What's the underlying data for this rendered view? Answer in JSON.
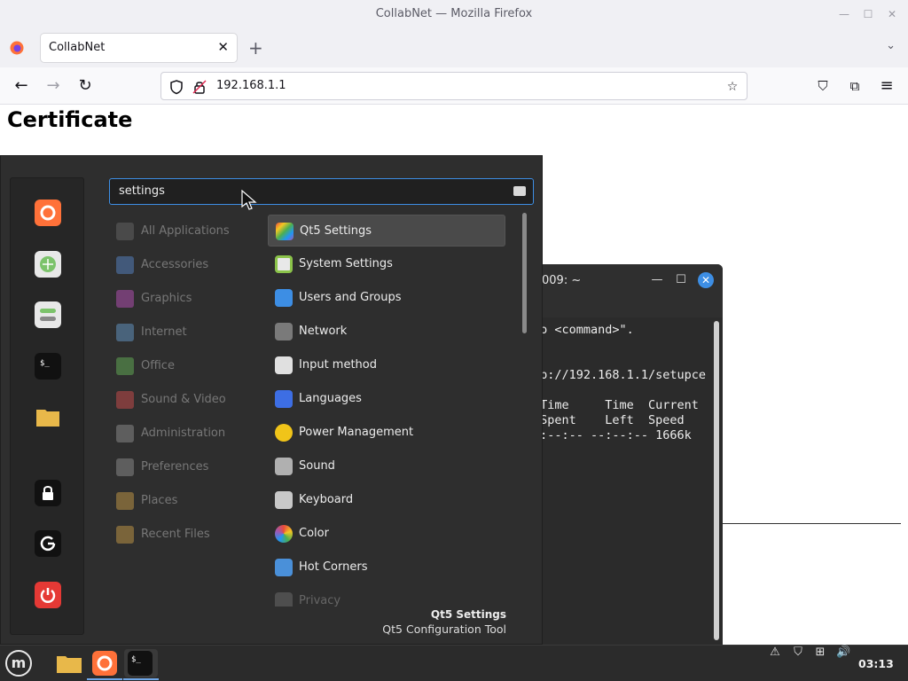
{
  "window": {
    "title": "CollabNet — Mozilla Firefox",
    "minimize_icon": "—",
    "maximize_icon": "☐",
    "close_icon": "✕"
  },
  "browser": {
    "tab_label": "CollabNet",
    "tab_close_icon": "✕",
    "new_tab_icon": "+",
    "tab_list_icon": "⌄",
    "back_icon": "←",
    "forward_icon": "→",
    "reload_icon": "↻",
    "url": "192.168.1.1",
    "bookmark_icon": "☆",
    "pocket_icon": "⛉",
    "extensions_icon": "⧉",
    "menu_icon": "≡"
  },
  "page": {
    "heading": "Certificate"
  },
  "terminal": {
    "title": "009: ~",
    "lines": [
      "do <command>\".",
      "",
      "tp://192.168.1.1/setupce",
      "",
      " Time     Time  Current",
      " Spent    Left  Speed",
      "-:--:-- --:--:-- 1666k"
    ]
  },
  "menu": {
    "search_value": "settings",
    "categories": [
      {
        "label": "All Applications",
        "color": "#6d6d6d"
      },
      {
        "label": "Accessories",
        "color": "#5a8fd6"
      },
      {
        "label": "Graphics",
        "color": "#c855c8"
      },
      {
        "label": "Internet",
        "color": "#6aa3d9"
      },
      {
        "label": "Office",
        "color": "#6bbf5b"
      },
      {
        "label": "Sound & Video",
        "color": "#e05050"
      },
      {
        "label": "Administration",
        "color": "#9a9a9a"
      },
      {
        "label": "Preferences",
        "color": "#9a9a9a"
      },
      {
        "label": "Places",
        "color": "#d8a64a"
      },
      {
        "label": "Recent Files",
        "color": "#d8a64a"
      }
    ],
    "apps": [
      {
        "label": "Qt5 Settings",
        "color": "#9b59b6"
      },
      {
        "label": "System Settings",
        "color": "#8bc34a"
      },
      {
        "label": "Users and Groups",
        "color": "#3d8ee4"
      },
      {
        "label": "Network",
        "color": "#7a7a7a"
      },
      {
        "label": "Input method",
        "color": "#e0e0e0"
      },
      {
        "label": "Languages",
        "color": "#3d6ee4"
      },
      {
        "label": "Power Management",
        "color": "#f0c419"
      },
      {
        "label": "Sound",
        "color": "#b0b0b0"
      },
      {
        "label": "Keyboard",
        "color": "#c8c8c8"
      },
      {
        "label": "Color",
        "color": "#e8a0b8"
      },
      {
        "label": "Hot Corners",
        "color": "#4a90d9"
      },
      {
        "label": "Privacy",
        "color": "#8a8a8a"
      }
    ],
    "description_title": "Qt5 Settings",
    "description_subtitle": "Qt5 Configuration Tool"
  },
  "favorites": [
    {
      "name": "firefox",
      "color": "#ff7139"
    },
    {
      "name": "software-manager",
      "color": "#7cc36b"
    },
    {
      "name": "system-settings",
      "color": "#8a8a8a"
    },
    {
      "name": "terminal",
      "color": "#1a1a1a"
    },
    {
      "name": "files",
      "color": "#e8b84a"
    },
    {
      "name": "lock-screen",
      "color": "#1a1a1a"
    },
    {
      "name": "logout",
      "color": "#1a1a1a"
    },
    {
      "name": "shutdown",
      "color": "#e53935"
    }
  ],
  "taskbar": {
    "menu_button": "m",
    "clock": "03:13"
  }
}
